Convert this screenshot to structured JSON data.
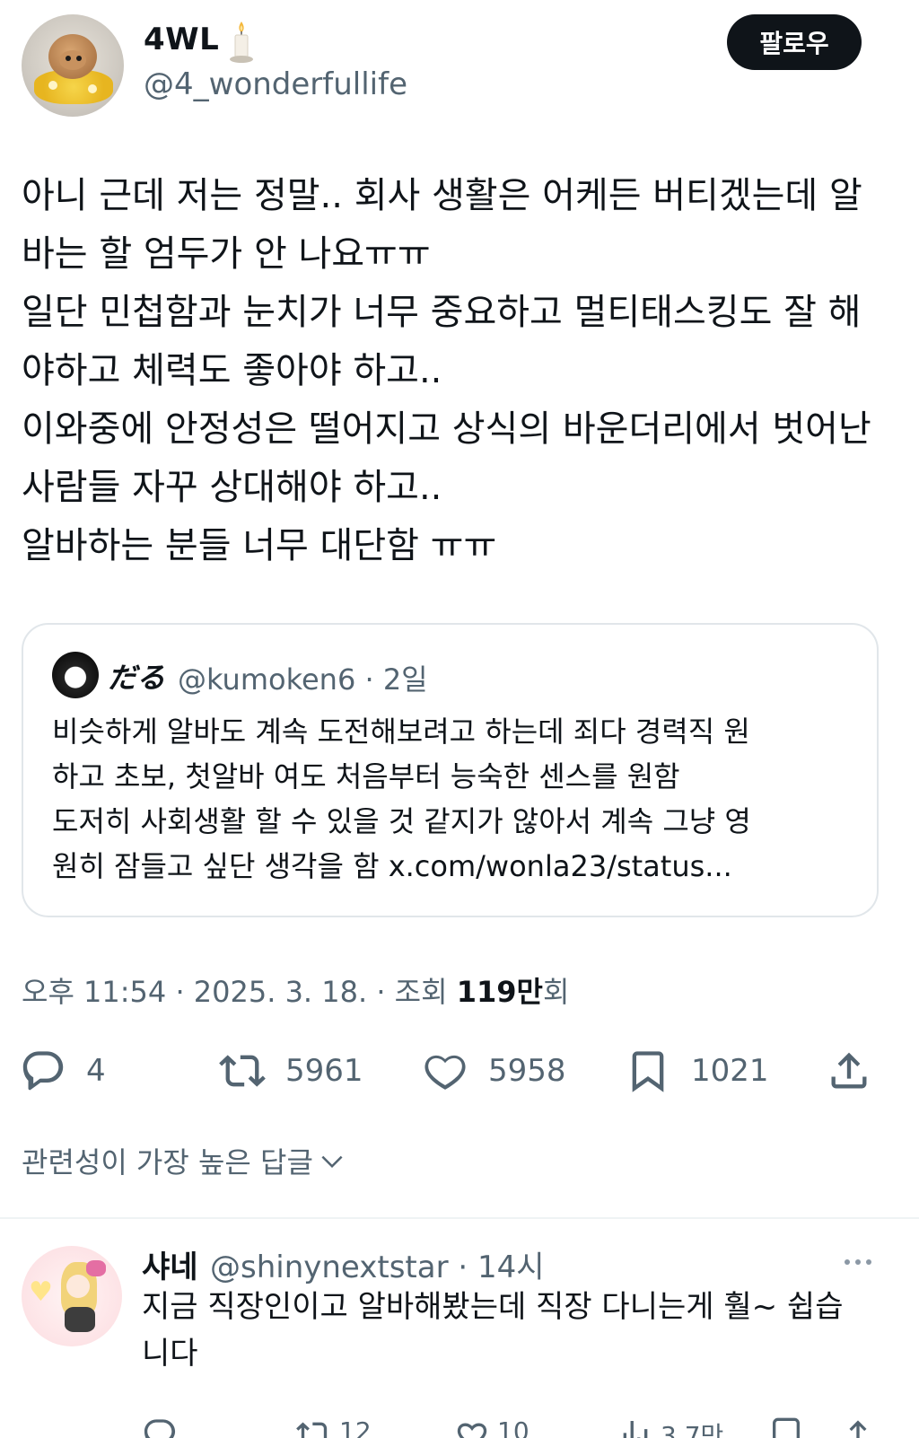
{
  "tweet": {
    "author_name": "4WL",
    "author_emoji": "candle-icon",
    "author_handle": "@4_wonderfullife",
    "follow_label": "팔로우",
    "text": "아니 근데 저는 정말.. 회사 생활은 어케든 버티겠는데 알\n바는 할 엄두가 안 나요ㅠㅠ\n일단 민첩함과 눈치가 너무 중요하고 멀티태스킹도 잘 해\n야하고 체력도 좋아야 하고..\n이와중에 안정성은 떨어지고 상식의 바운더리에서 벗어난\n사람들 자꾸 상대해야 하고..\n알바하는 분들 너무 대단함 ㅠㅠ",
    "quote": {
      "author_name": "だる",
      "meta": "@kumoken6 · 2일",
      "text": "비슷하게 알바도 계속 도전해보려고 하는데 죄다 경력직 원\n하고 초보, 첫알바 여도 처음부터 능숙한 센스를 원함\n도저히 사회생활 할 수 있을 것 같지가 않아서 계속 그냥 영\n원히 잠들고 싶단 생각을 함 x.com/wonla23/status..."
    },
    "timestamp_prefix": "오후 11:54 · 2025. 3. 18. · 조회 ",
    "views_number": "119만",
    "views_suffix": "회",
    "actions": {
      "replies": "4",
      "retweets": "5961",
      "likes": "5958",
      "bookmarks": "1021"
    }
  },
  "replies_sort_label": "관련성이 가장 높은 답글",
  "reply": {
    "author_name": "샤네",
    "meta": "@shinynextstar · 14시",
    "text": "지금 직장인이고 알바해봤는데 직장 다니는게 훨~ 쉽습\n니다",
    "actions": {
      "retweets": "12",
      "likes": "10",
      "views": "3.7만"
    }
  }
}
